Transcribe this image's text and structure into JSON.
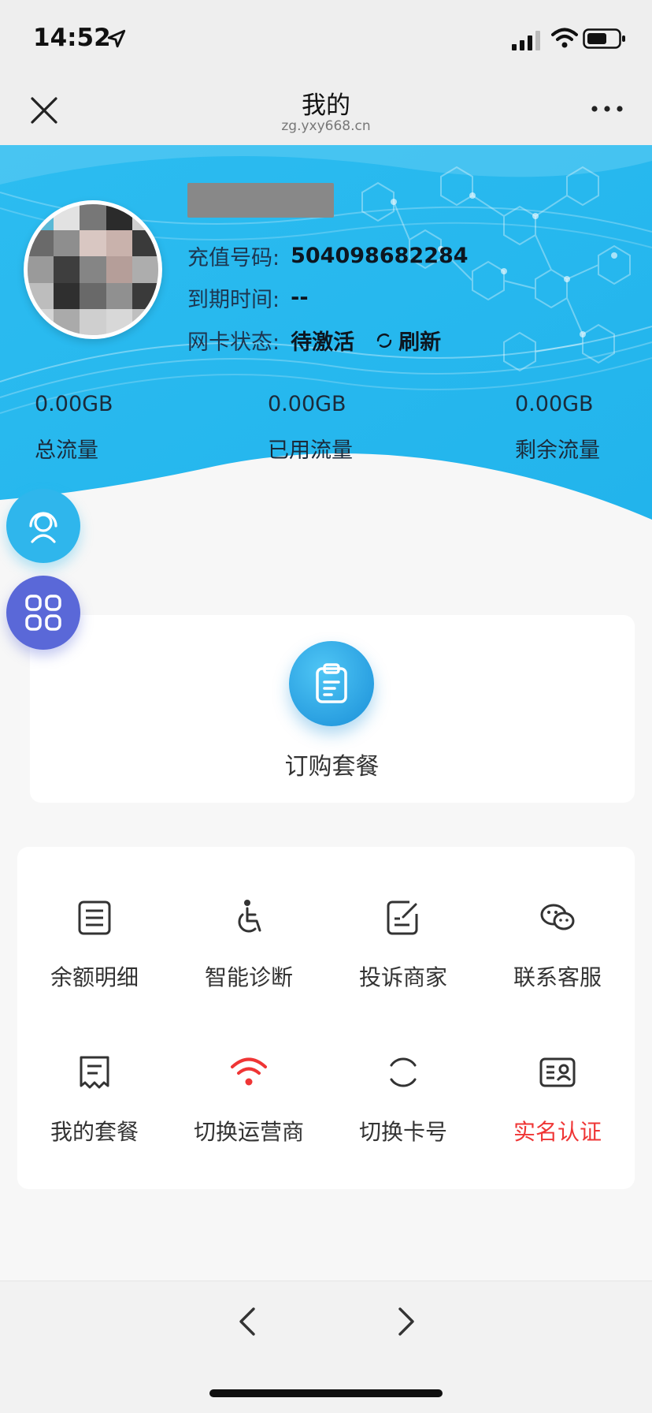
{
  "status_bar": {
    "time": "14:52"
  },
  "nav": {
    "title": "我的",
    "subtitle": "zg.yxy668.cn"
  },
  "profile": {
    "recharge_label": "充值号码:",
    "recharge_value": "504098682284",
    "expire_label": "到期时间:",
    "expire_value": "--",
    "status_label": "网卡状态:",
    "status_value": "待激活",
    "refresh_label": "刷新"
  },
  "stats": [
    {
      "value": "0.00GB",
      "label": "总流量"
    },
    {
      "value": "0.00GB",
      "label": "已用流量"
    },
    {
      "value": "0.00GB",
      "label": "剩余流量"
    }
  ],
  "order": {
    "label": "订购套餐"
  },
  "functions": [
    {
      "label": "余额明细",
      "icon": "balance-detail-icon"
    },
    {
      "label": "智能诊断",
      "icon": "accessibility-icon"
    },
    {
      "label": "投诉商家",
      "icon": "complaint-icon"
    },
    {
      "label": "联系客服",
      "icon": "wechat-icon"
    },
    {
      "label": "我的套餐",
      "icon": "receipt-icon"
    },
    {
      "label": "切换运营商",
      "icon": "wifi-icon"
    },
    {
      "label": "切换卡号",
      "icon": "switch-card-icon"
    },
    {
      "label": "实名认证",
      "icon": "id-card-icon"
    }
  ],
  "colors": {
    "header_blue": "#28b8ee",
    "accent_red": "#ef3535",
    "apps_purple": "#5a68d8"
  }
}
